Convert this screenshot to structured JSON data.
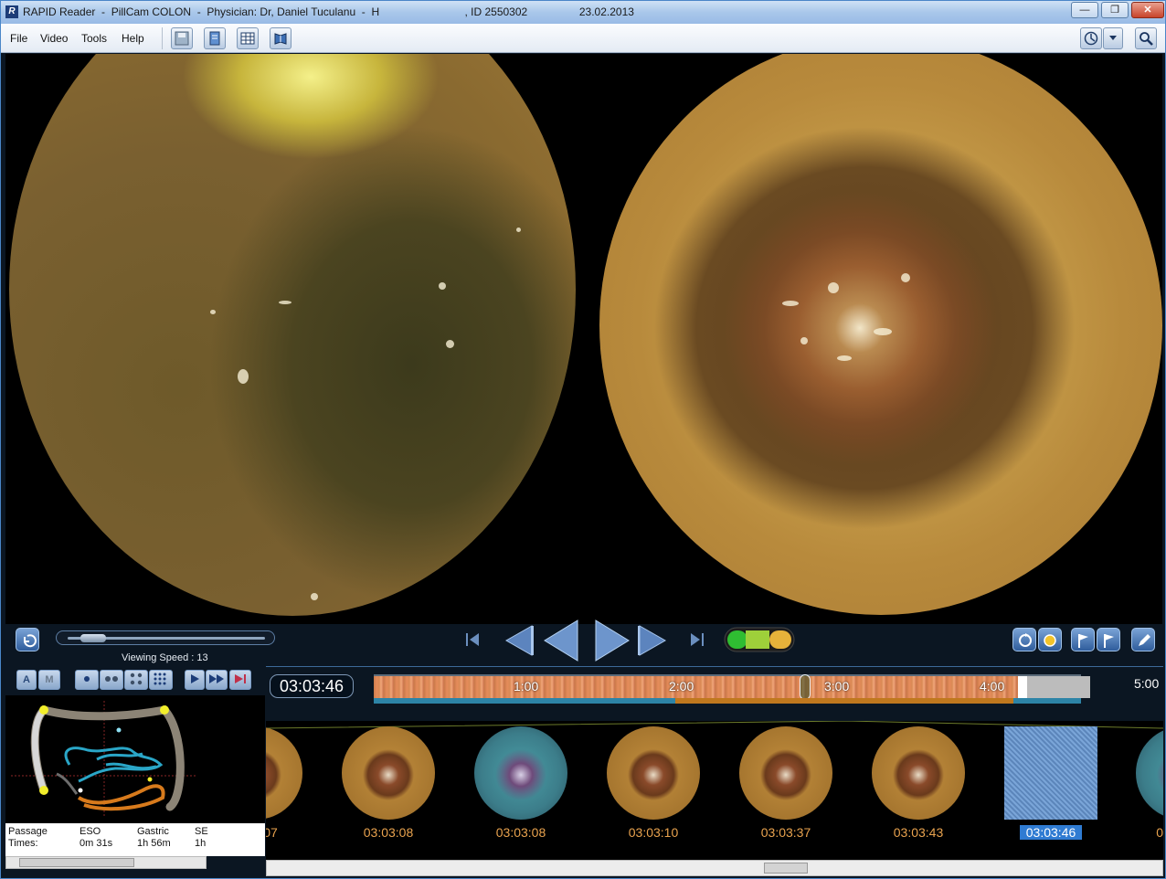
{
  "window": {
    "title": "RAPID Reader  -  PillCam COLON  -  Physician: Dr, Daniel Tuculanu  -  H                            , ID 2550302                 23.02.2013",
    "minimize": "—",
    "maximize": "❐",
    "close": "✕"
  },
  "menu": {
    "items": [
      "File",
      "Video",
      "Tools",
      "Help"
    ]
  },
  "icons": {
    "toolbar": [
      "save-icon",
      "report-icon",
      "table-icon",
      "atlas-icon"
    ],
    "right": [
      "compass-icon",
      "dropdown-icon",
      "zoom-icon"
    ]
  },
  "controls": {
    "viewing_speed_label": "Viewing Speed : 13",
    "speed_value": 13
  },
  "modes": {
    "a": "A",
    "m": "M"
  },
  "timeline": {
    "current_time": "03:03:46",
    "ticks": [
      "1:00",
      "2:00",
      "3:00",
      "4:00"
    ],
    "end_label": "5:00",
    "progress_fraction": 0.61
  },
  "passage": {
    "label_1": "Passage",
    "label_2": "Times:",
    "eso_label": "ESO",
    "eso_value": "0m 31s",
    "gastric_label": "Gastric",
    "gastric_value": "1h 56m",
    "sb_label": "SE",
    "sb_value": "1h"
  },
  "thumbnails": [
    {
      "time": "07"
    },
    {
      "time": "03:03:08"
    },
    {
      "time": "03:03:08"
    },
    {
      "time": "03:03:10"
    },
    {
      "time": "03:03:37"
    },
    {
      "time": "03:03:43"
    },
    {
      "time": "03:03:46"
    },
    {
      "time": "0"
    }
  ],
  "colors": {
    "accent": "#2f7bd2",
    "thumb_time": "#e8a24e"
  }
}
